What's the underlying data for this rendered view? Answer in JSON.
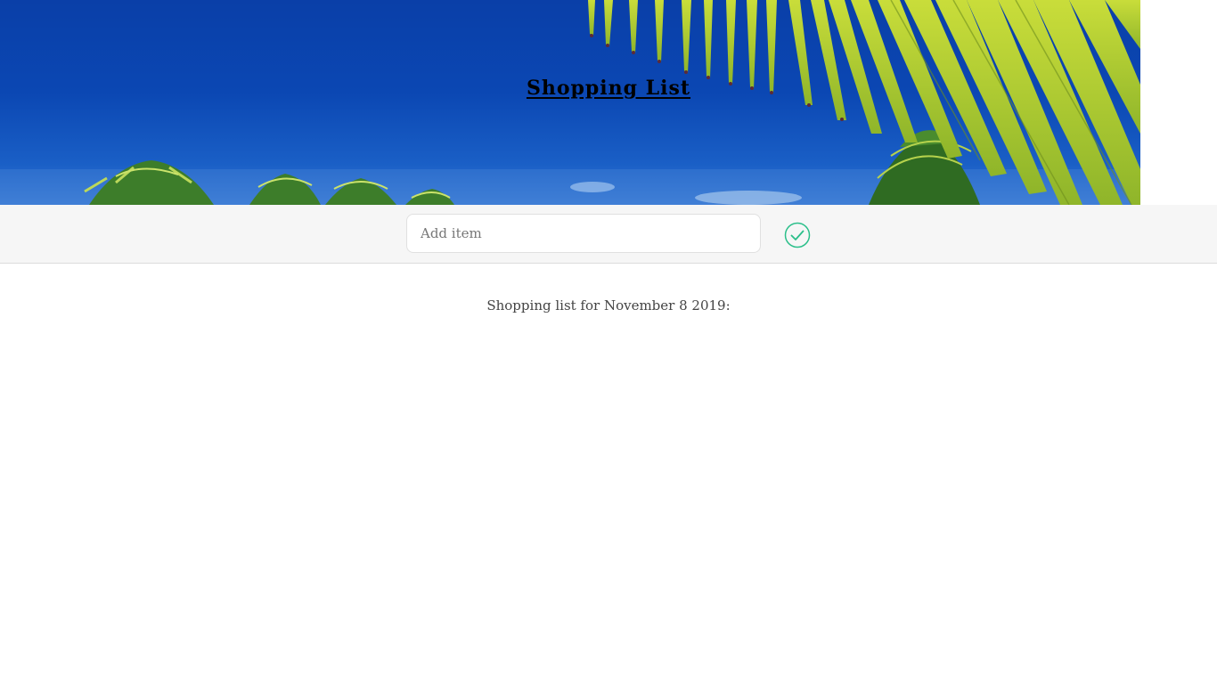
{
  "header": {
    "title": "Shopping List",
    "background_image": "tropical-palm-sky",
    "sky_color": "#0b47b3"
  },
  "add_form": {
    "input_placeholder": "Add item",
    "input_value": "",
    "submit_icon": "check-circle-icon",
    "accent_color": "#2bbf8a"
  },
  "list": {
    "heading": "Shopping list for November 8 2019:",
    "items": []
  }
}
